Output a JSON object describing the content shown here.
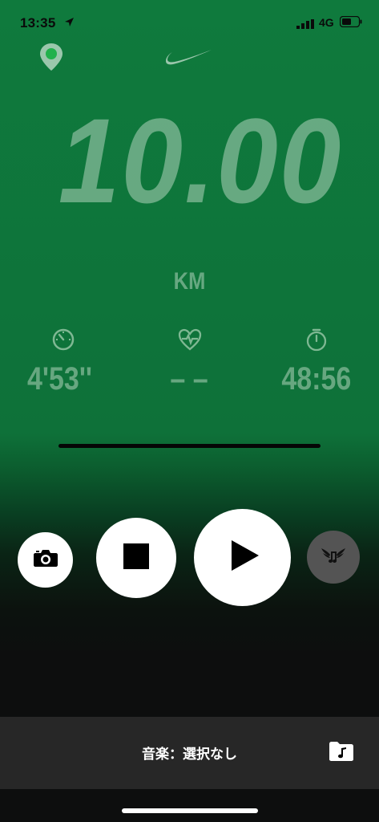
{
  "status_bar": {
    "time": "13:35",
    "network": "4G",
    "icons": [
      "location-arrow-icon",
      "signal-icon",
      "battery-icon"
    ]
  },
  "header": {
    "icons": [
      "map-pin-icon",
      "nike-swoosh-icon"
    ]
  },
  "run": {
    "distance": "10.00",
    "unit": "KM",
    "pace": "4'53''",
    "heart_rate": "– –",
    "duration": "48:56",
    "metric_icons": [
      "pace-gauge-icon",
      "heart-rate-icon",
      "stopwatch-icon"
    ]
  },
  "controls": {
    "icons": [
      "camera-icon",
      "stop-icon",
      "play-icon",
      "music-wings-icon"
    ]
  },
  "music": {
    "label": "音楽：選択なし",
    "icon": "music-folder-icon"
  },
  "colors": {
    "background_green": "#0f7a3d",
    "background_dark": "#0d0e0e",
    "faded_text": "#b0d4bc",
    "button_white": "#ffffff",
    "music_button": "#545454",
    "music_bar": "#272727"
  }
}
